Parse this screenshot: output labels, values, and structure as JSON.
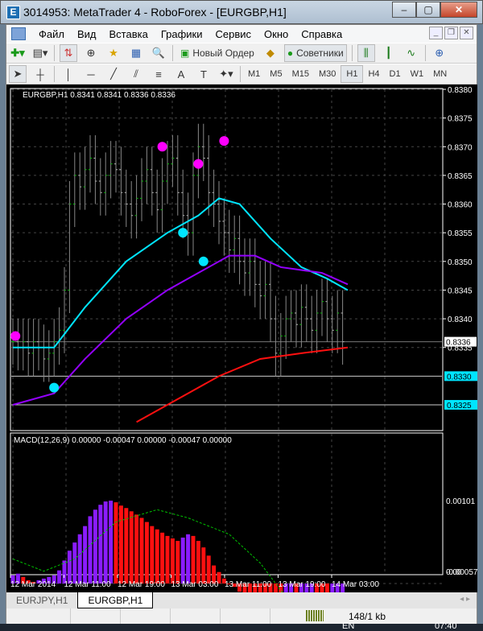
{
  "window": {
    "title": "3014953: MetaTrader 4 - RoboForex - [EURGBP,H1]",
    "minimize": "‒",
    "maximize": "▢",
    "close": "✕"
  },
  "menu": [
    "Файл",
    "Вид",
    "Вставка",
    "Графики",
    "Сервис",
    "Окно",
    "Справка"
  ],
  "mdi_buttons": [
    "_",
    "❐",
    "✕"
  ],
  "toolbar1": {
    "new_order": "Новый Ордер",
    "experts": "Советники"
  },
  "timeframes": [
    "M1",
    "M5",
    "M15",
    "M30",
    "H1",
    "H4",
    "D1",
    "W1",
    "MN"
  ],
  "active_timeframe": "H1",
  "chart": {
    "header": "EURGBP,H1  0.8341 0.8341 0.8336 0.8336",
    "price_labels": [
      "0.8380",
      "0.8375",
      "0.8370",
      "0.8365",
      "0.8360",
      "0.8355",
      "0.8350",
      "0.8345",
      "0.8340",
      "0.8335"
    ],
    "current_price": "0.8336",
    "hline_labels": [
      "0.8330",
      "0.8325"
    ],
    "time_labels": [
      "12 Mar 2014",
      "12 Mar 11:00",
      "12 Mar 19:00",
      "13 Mar 03:00",
      "13 Mar 11:00",
      "13 Mar 19:00",
      "14 Mar 03:00"
    ],
    "colors": {
      "bull": "#00c000",
      "bear": "#ffffff",
      "ma_fast": "#00e5ff",
      "ma_mid": "#9400ff",
      "ma_slow": "#ff1010",
      "buy_dot": "#ff00ff",
      "sell_dot": "#00e5ff",
      "macd_up": "#8a1cff",
      "macd_down": "#ff1010",
      "signal": "#00c000"
    },
    "closes": [
      0.8336,
      0.8335,
      0.8336,
      0.8334,
      0.8336,
      0.8335,
      0.8333,
      0.8334,
      0.8336,
      0.8338,
      0.8345,
      0.836,
      0.8365,
      0.8363,
      0.8366,
      0.8368,
      0.8364,
      0.8362,
      0.8365,
      0.8367,
      0.8366,
      0.8362,
      0.836,
      0.8358,
      0.8361,
      0.8364,
      0.8366,
      0.8362,
      0.8359,
      0.8364,
      0.8367,
      0.8368,
      0.8362,
      0.8358,
      0.8355,
      0.8365,
      0.837,
      0.8368,
      0.8362,
      0.836,
      0.8357,
      0.8355,
      0.8352,
      0.8354,
      0.835,
      0.8348,
      0.835,
      0.8346,
      0.8344,
      0.8346,
      0.834,
      0.8334,
      0.8337,
      0.834,
      0.8341,
      0.8339,
      0.8342,
      0.834,
      0.8338,
      0.8341,
      0.8343,
      0.834,
      0.8338,
      0.8341,
      0.8336
    ],
    "ma_fast": [
      [
        0,
        0.8335
      ],
      [
        8,
        0.8335
      ],
      [
        14,
        0.8342
      ],
      [
        22,
        0.835
      ],
      [
        30,
        0.8355
      ],
      [
        36,
        0.8358
      ],
      [
        40,
        0.8361
      ],
      [
        44,
        0.836
      ],
      [
        50,
        0.8354
      ],
      [
        56,
        0.8349
      ],
      [
        61,
        0.8347
      ],
      [
        65,
        0.8345
      ]
    ],
    "ma_mid": [
      [
        0,
        0.8325
      ],
      [
        8,
        0.8327
      ],
      [
        14,
        0.8333
      ],
      [
        22,
        0.834
      ],
      [
        30,
        0.8345
      ],
      [
        38,
        0.8349
      ],
      [
        42,
        0.8351
      ],
      [
        47,
        0.8351
      ],
      [
        52,
        0.8349
      ],
      [
        60,
        0.8348
      ],
      [
        65,
        0.8346
      ]
    ],
    "ma_slow": [
      [
        24,
        0.8322
      ],
      [
        34,
        0.8327
      ],
      [
        40,
        0.833
      ],
      [
        48,
        0.8333
      ],
      [
        56,
        0.8334
      ],
      [
        65,
        0.8335
      ]
    ],
    "buy_dots": [
      [
        0.5,
        0.8337
      ],
      [
        29,
        0.837
      ],
      [
        36,
        0.8367
      ],
      [
        41,
        0.8371
      ]
    ],
    "sell_dots": [
      [
        8,
        0.8328
      ],
      [
        33,
        0.8355
      ],
      [
        37,
        0.835
      ]
    ],
    "ylim": [
      0.8325,
      0.838
    ]
  },
  "macd": {
    "header": "MACD(12,26,9) 0.00000 -0.00047 0.00000 -0.00047 0.00000",
    "labels": [
      "0.00101",
      "0.00",
      "-0.00057"
    ],
    "hist": [
      0.0001,
      0.00012,
      8e-05,
      4e-05,
      2e-05,
      4e-05,
      6e-05,
      8e-05,
      0.0001,
      0.00016,
      0.00028,
      0.0004,
      0.0005,
      0.0006,
      0.0007,
      0.00082,
      0.0009,
      0.00096,
      0.001,
      0.00101,
      0.00099,
      0.00095,
      0.00092,
      0.00088,
      0.00084,
      0.0008,
      0.00075,
      0.0007,
      0.00066,
      0.00062,
      0.00058,
      0.00055,
      0.00052,
      0.00056,
      0.0006,
      0.00058,
      0.00052,
      0.00044,
      0.00034,
      0.00022,
      0.00014,
      6e-05,
      0.0,
      -4e-05,
      -0.0001,
      -0.00018,
      -0.00026,
      -0.00032,
      -0.00038,
      -0.00042,
      -0.00045,
      -0.00048,
      -0.0005,
      -0.0005,
      -0.0005,
      -0.00052,
      -0.0005,
      -0.0005,
      -0.00048,
      -0.0005,
      -0.00052,
      -0.00054,
      -0.0005,
      -0.00049,
      -0.00047
    ],
    "signal": [
      [
        0,
        0.0003
      ],
      [
        6,
        0.00015
      ],
      [
        12,
        0.0003
      ],
      [
        20,
        0.00075
      ],
      [
        28,
        0.0009
      ],
      [
        34,
        0.0008
      ],
      [
        42,
        0.0006
      ],
      [
        48,
        0.00025
      ],
      [
        54,
        -0.00025
      ],
      [
        60,
        -0.00048
      ],
      [
        65,
        -0.0005
      ]
    ]
  },
  "tabs": [
    "EURJPY,H1",
    "EURGBP,H1"
  ],
  "active_tab": "EURGBP,H1",
  "status": {
    "traffic": "148/1 kb"
  },
  "taskbar": {
    "lang": "EN",
    "clock": "07:40"
  }
}
